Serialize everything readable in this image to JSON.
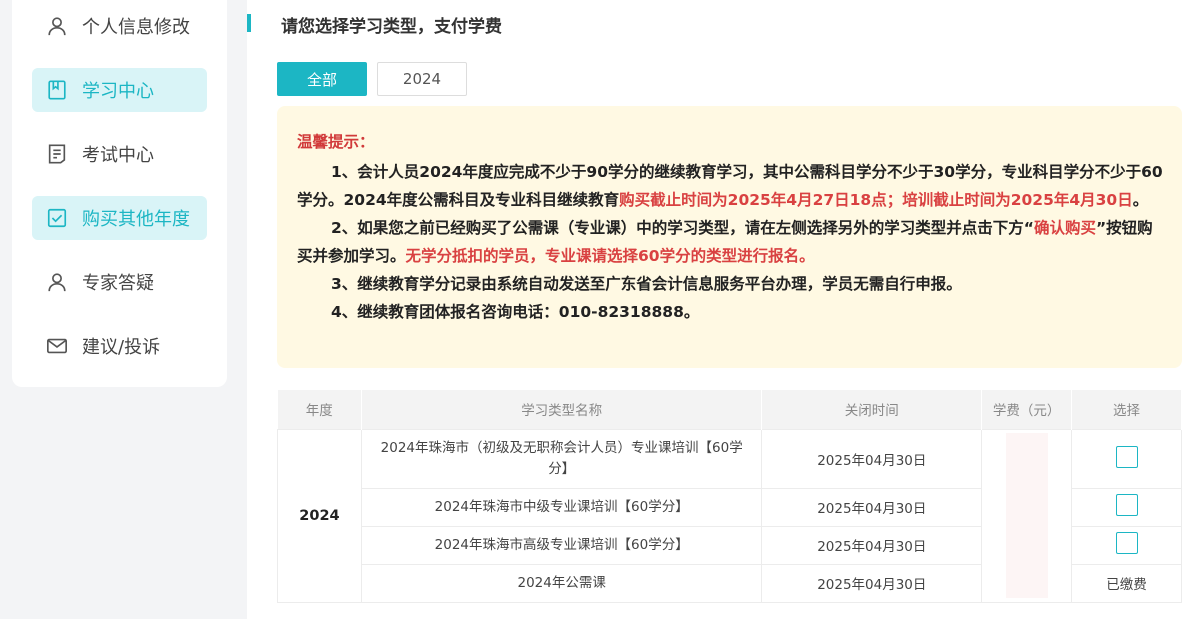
{
  "sidebar": {
    "items": [
      {
        "label": "个人信息修改",
        "icon": "user-icon",
        "active": false
      },
      {
        "label": "学习中心",
        "icon": "book-icon",
        "active": true
      },
      {
        "label": "考试中心",
        "icon": "exam-icon",
        "active": false
      },
      {
        "label": "购买其他年度",
        "icon": "checkbox-icon",
        "active": true
      },
      {
        "label": "专家答疑",
        "icon": "user-icon",
        "active": false
      },
      {
        "label": "建议/投诉",
        "icon": "mail-icon",
        "active": false
      }
    ]
  },
  "main": {
    "title": "请您选择学习类型，支付学费",
    "tabs": [
      {
        "label": "全部",
        "active": true
      },
      {
        "label": "2024",
        "active": false
      }
    ],
    "notice": {
      "heading": "温馨提示：",
      "p1_a": "1、会计人员2024年度应完成不少于90学分的继续教育学习，其中公需科目学分不少于30学分，专业科目学分不少于60学分。2024年度公需科目及专业科目继续教育",
      "p1_red": "购买截止时间为2025年4月27日18点；培训截止时间为2025年4月30日",
      "p1_end": "。",
      "p2_a": "2、如果您之前已经购买了公需课（专业课）中的学习类型，请在左侧选择另外的学习类型并点击下方“",
      "p2_red1": "确认购买",
      "p2_b": "”按钮购买并参加学习。",
      "p2_red2": "无学分抵扣的学员，专业课请选择60学分的类型进行报名。",
      "p3": "3、继续教育学分记录由系统自动发送至广东省会计信息服务平台办理，学员无需自行申报。",
      "p4": "4、继续教育团体报名咨询电话：010-82318888。"
    },
    "table": {
      "headers": [
        "年度",
        "学习类型名称",
        "关闭时间",
        "学费（元）",
        "选择"
      ],
      "year": "2024",
      "rows": [
        {
          "name": "2024年珠海市（初级及无职称会计人员）专业课培训【60学分】",
          "close_time": "2025年04月30日",
          "select": "checkbox"
        },
        {
          "name": "2024年珠海市中级专业课培训【60学分】",
          "close_time": "2025年04月30日",
          "select": "checkbox"
        },
        {
          "name": "2024年珠海市高级专业课培训【60学分】",
          "close_time": "2025年04月30日",
          "select": "checkbox"
        },
        {
          "name": "2024年公需课",
          "close_time": "2025年04月30日",
          "select": "已缴费"
        }
      ]
    }
  },
  "colors": {
    "accent": "#1cb6c4",
    "notice_bg": "#fff9e3",
    "red": "#d94141"
  }
}
